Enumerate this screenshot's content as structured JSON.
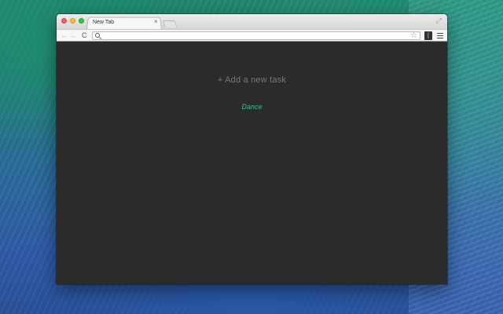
{
  "browser": {
    "tab": {
      "label": "New Tab",
      "close_glyph": "×"
    },
    "fullscreen_glyph": "⤢",
    "nav": {
      "back_glyph": "←",
      "forward_glyph": "→",
      "reload_glyph": "C"
    },
    "omnibox": {
      "value": "",
      "star_glyph": "☆"
    },
    "extension_glyph": "[",
    "icons": [
      "close-window-icon",
      "minimize-icon",
      "maximize-icon",
      "fullscreen-icon",
      "search-icon",
      "star-icon",
      "extension-icon",
      "menu-icon"
    ]
  },
  "page": {
    "add_task_label": "+ Add a new task",
    "done_label": "Dance",
    "colors": {
      "background": "#2b2b2b",
      "add_task_text": "#787878",
      "done_text": "#3fbf8f"
    }
  }
}
